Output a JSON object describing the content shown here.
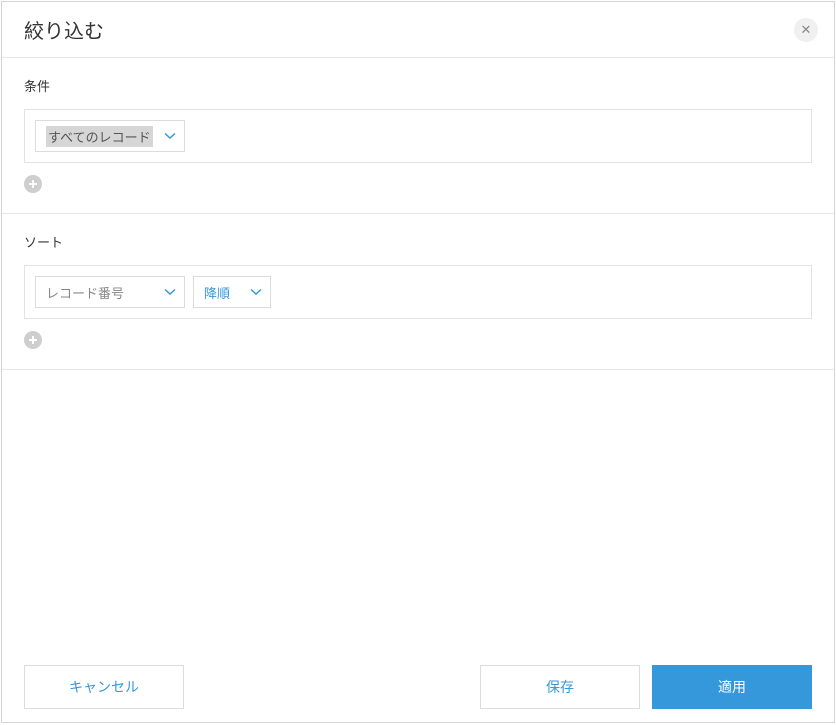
{
  "dialog": {
    "title": "絞り込む"
  },
  "conditions": {
    "label": "条件",
    "dropdown": {
      "value": "すべてのレコード"
    }
  },
  "sort": {
    "label": "ソート",
    "field": {
      "value": "レコード番号"
    },
    "order": {
      "value": "降順"
    }
  },
  "footer": {
    "cancel": "キャンセル",
    "save": "保存",
    "apply": "適用"
  }
}
